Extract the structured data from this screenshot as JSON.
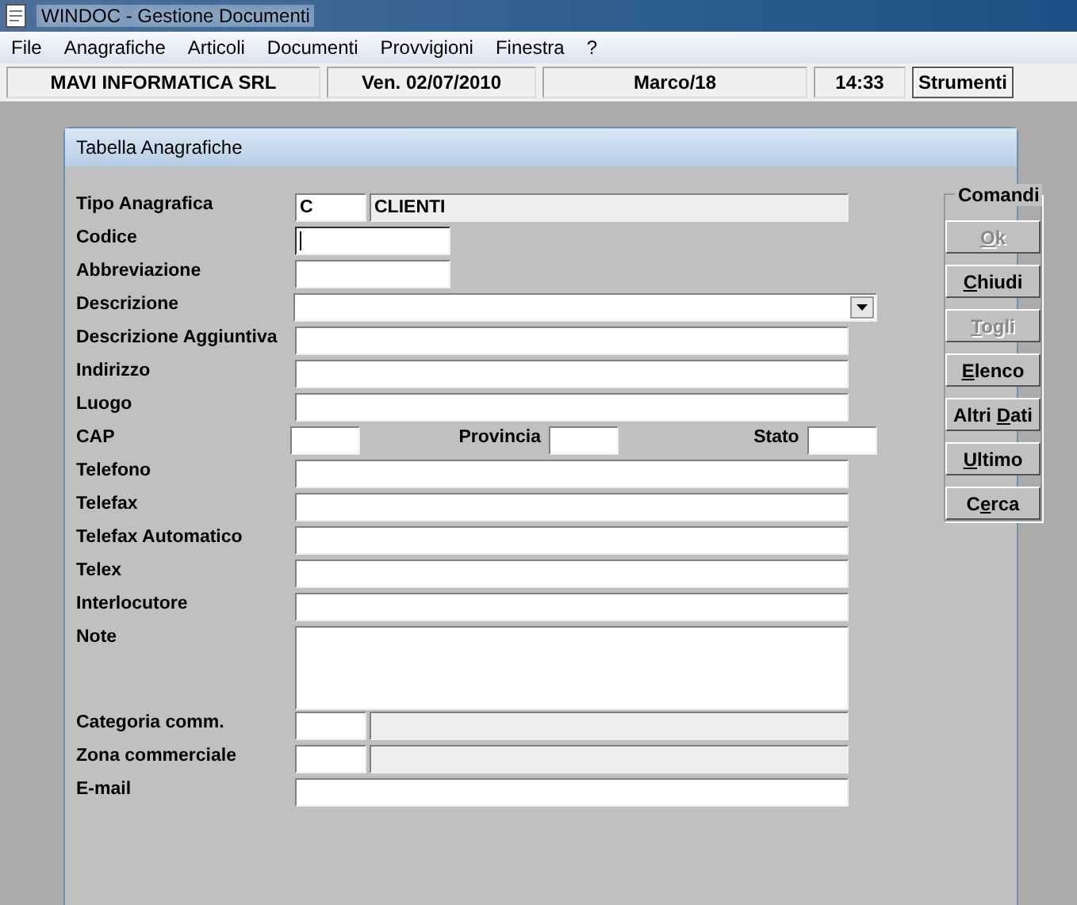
{
  "window": {
    "title": "WINDOC - Gestione Documenti"
  },
  "menu": [
    "File",
    "Anagrafiche",
    "Articoli",
    "Documenti",
    "Provvigioni",
    "Finestra",
    "?"
  ],
  "toolbar": {
    "panels": [
      "MAVI INFORMATICA SRL",
      "Ven. 02/07/2010",
      "Marco/18",
      "14:33"
    ],
    "button": "Strumenti"
  },
  "dialog": {
    "title": "Tabella Anagrafiche",
    "rows": [
      {
        "label": "Tipo Anagrafica",
        "kind": "pair",
        "value": "C",
        "desc": "CLIENTI",
        "focused": false
      },
      {
        "label": "Codice",
        "kind": "short",
        "focused": true
      },
      {
        "label": "Abbreviazione",
        "kind": "short",
        "focused": false
      },
      {
        "label": "Descrizione",
        "kind": "dropdown",
        "focused": false
      },
      {
        "label": "Descrizione Aggiuntiva",
        "kind": "text",
        "focused": false
      },
      {
        "label": "Indirizzo",
        "kind": "text",
        "focused": false
      },
      {
        "label": "Luogo",
        "kind": "text",
        "focused": false
      },
      {
        "label": "CAP",
        "kind": "cap",
        "extras": [
          "Provincia",
          "Stato"
        ],
        "focused": false
      },
      {
        "label": "Telefono",
        "kind": "text",
        "focused": false
      },
      {
        "label": "Telefax",
        "kind": "text",
        "focused": false
      },
      {
        "label": "Telefax Automatico",
        "kind": "text",
        "focused": false
      },
      {
        "label": "Telex",
        "kind": "text",
        "focused": false
      },
      {
        "label": "Interlocutore",
        "kind": "text",
        "focused": false
      },
      {
        "label": "Note",
        "kind": "textarea",
        "focused": false
      },
      {
        "label": "Categoria comm.",
        "kind": "pair",
        "focused": false
      },
      {
        "label": "Zona commerciale",
        "kind": "pair",
        "focused": false
      },
      {
        "label": "E-mail",
        "kind": "text",
        "focused": false
      }
    ],
    "commands": {
      "title": "Comandi",
      "buttons": [
        {
          "key": "O",
          "post": "k",
          "disabled": true
        },
        {
          "key": "C",
          "post": "hiudi",
          "disabled": false
        },
        {
          "key": "T",
          "post": "ogli",
          "disabled": true
        },
        {
          "key": "E",
          "post": "lenco",
          "disabled": false
        },
        {
          "pre": "Altri ",
          "key": "D",
          "post": "ati",
          "disabled": false
        },
        {
          "key": "U",
          "post": "ltimo",
          "disabled": false
        },
        {
          "pre": "C",
          "key": "e",
          "post": "rca",
          "disabled": false
        }
      ]
    }
  }
}
